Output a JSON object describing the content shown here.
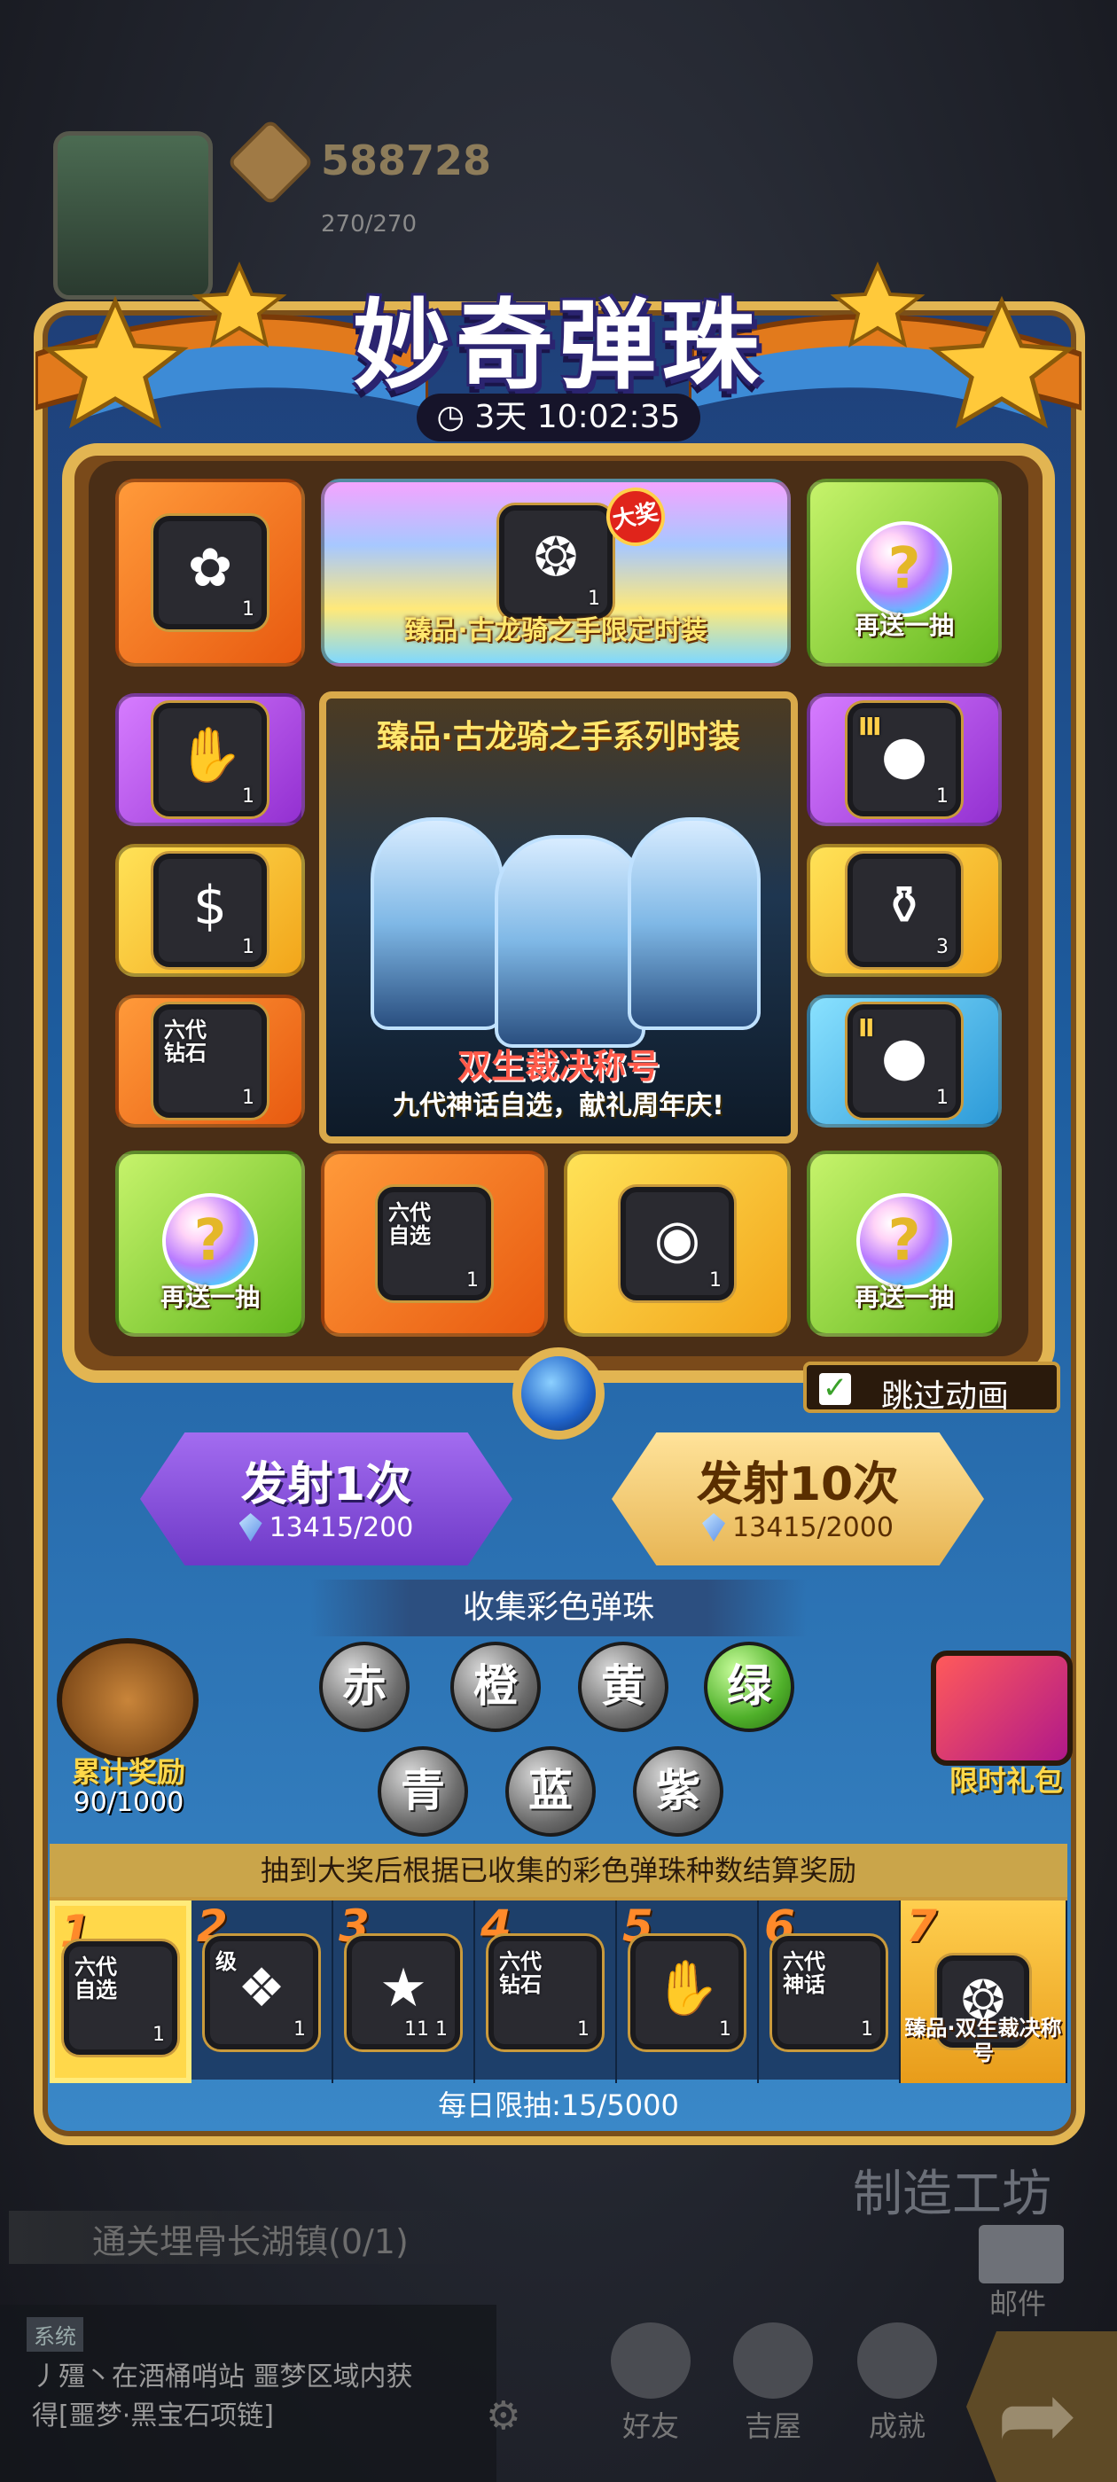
{
  "hud": {
    "coins": "588728",
    "energy": "270/270"
  },
  "event": {
    "title": "妙奇弹珠",
    "timer": "3天 10:02:35"
  },
  "grand_prize": {
    "badge": "大奖",
    "label": "臻品·古龙骑之手限定时装",
    "count": "1"
  },
  "showcase": {
    "title": "臻品·古龙骑之手系列时装",
    "headline": "双生裁决称号",
    "subline": "九代神话自选，献礼周年庆!"
  },
  "tiles": {
    "top_left": {
      "count": "1"
    },
    "left_1": {
      "count": "1"
    },
    "left_2": {
      "count": "1"
    },
    "left_3": {
      "label": "六代",
      "label2": "钻石",
      "count": "1"
    },
    "right_1": {
      "tier": "Ⅲ",
      "count": "1"
    },
    "right_2": {
      "count": "3"
    },
    "right_3": {
      "tier": "Ⅱ",
      "count": "1"
    },
    "bottom_2": {
      "label": "六代",
      "label2": "自选",
      "count": "1"
    },
    "bottom_3": {
      "count": "1"
    },
    "bonus_label": "再送一抽",
    "bonus_glyph": "?"
  },
  "skip_animation": {
    "label": "跳过动画",
    "checked": "✓"
  },
  "buttons": {
    "launch_once": {
      "label": "发射1次",
      "cost": "13415/200"
    },
    "launch_ten": {
      "label": "发射10次",
      "cost": "13415/2000"
    }
  },
  "collect": {
    "title": "收集彩色弹珠",
    "orbs": [
      "赤",
      "橙",
      "黄",
      "绿",
      "青",
      "蓝",
      "紫"
    ],
    "lit": [
      "绿"
    ]
  },
  "cumulative": {
    "label": "累计奖励",
    "progress": "90/1000"
  },
  "gift_pack": {
    "label": "限时礼包"
  },
  "track": {
    "note": "抽到大奖后根据已收集的彩色弹珠种数结算奖励",
    "slots": [
      {
        "num": "1",
        "label": "六代",
        "label2": "自选",
        "count": "1"
      },
      {
        "num": "2",
        "label": "级",
        "count": "1"
      },
      {
        "num": "3",
        "count": "11 1"
      },
      {
        "num": "4",
        "label": "六代",
        "label2": "钻石",
        "count": "1"
      },
      {
        "num": "5",
        "count": "1"
      },
      {
        "num": "6",
        "label": "六代",
        "label2": "神话",
        "count": "1"
      },
      {
        "num": "7",
        "caption": "臻品·双生裁决称号",
        "count": "1"
      }
    ],
    "daily_limit": "每日限抽:15/5000"
  },
  "background_ui": {
    "craft": "制造工坊",
    "quest": "通关埋骨长湖镇(0/1)",
    "mail": "邮件",
    "chat_tag": "系统",
    "chat_line1": "丿殭丶在酒桶哨站 噩梦区域内获",
    "chat_line2": "得[噩梦·黑宝石项链]",
    "nav": [
      "好友",
      "吉屋",
      "成就"
    ]
  },
  "colors": {
    "gold": "#e2b552",
    "panel_blue": "#1d5c9e",
    "launch_purple": "#6e39c7",
    "launch_gold": "#e7b554"
  }
}
